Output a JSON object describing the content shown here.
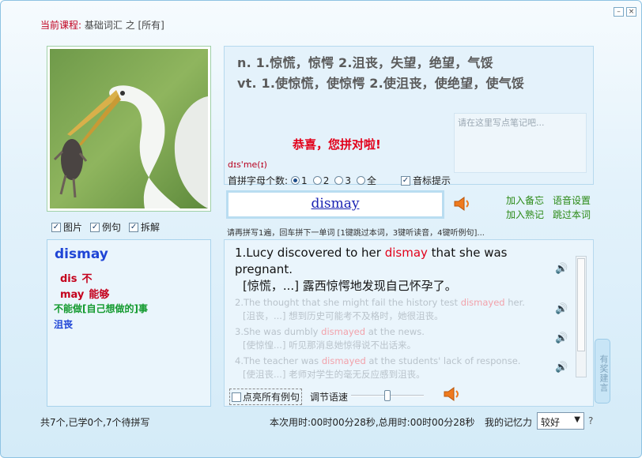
{
  "window": {
    "minimize_symbol": "–",
    "close_symbol": "×"
  },
  "course": {
    "label": "当前课程:",
    "value": "基础词汇 之 [所有]"
  },
  "options": {
    "picture": "图片",
    "example": "例句",
    "split": "拆解",
    "picture_checked": true,
    "example_checked": true,
    "split_checked": true
  },
  "split": {
    "word": "dismay",
    "parts": [
      {
        "piece": "dis",
        "meaning": "不"
      },
      {
        "piece": "may",
        "meaning": "能够"
      }
    ],
    "combined": "不能做[自己想做的]事",
    "result": "沮丧"
  },
  "definition": {
    "lines": [
      "n.  1.惊慌，惊愕  2.沮丧，失望，绝望，气馁",
      "vt.  1.使惊慌，使惊愕  2.使沮丧，使绝望，使气馁"
    ],
    "note_placeholder": "请在这里写点笔记吧...",
    "congrats": "恭喜，您拼对啦!",
    "phonetic": "dɪs'me(ɪ)",
    "letters_label": "首拼字母个数:",
    "letter_options": [
      "1",
      "2",
      "3",
      "全"
    ],
    "letter_selected": "1",
    "phonetic_hint": "音标提示",
    "phonetic_hint_checked": true
  },
  "answer": {
    "word": "dismay"
  },
  "actions": {
    "add_memo": "加入备忘",
    "add_known": "加入熟记",
    "voice_settings": "语音设置",
    "skip": "跳过本词"
  },
  "hint": "请再拼写1遍，回车拼下一单词 [1键跳过本词，3键听读音，4键听例句]...",
  "examples": {
    "main_pre": "1.Lucy discovered to her ",
    "main_kw": "dismay",
    "main_post": " that she was pregnant.",
    "main_cn": "[惊慌，...] 露西惊愕地发现自己怀孕了。",
    "others": [
      {
        "en_pre": "2.The thought that she might fail the history test ",
        "kw": "dismayed",
        "en_post": " her.",
        "cn": "[沮丧，...] 想到历史可能考不及格时，她很沮丧。"
      },
      {
        "en_pre": "3.She was dumbly ",
        "kw": "dismayed",
        "en_post": " at the news.",
        "cn": "[使惊惶...] 听见那消息她惊得说不出话来。"
      },
      {
        "en_pre": "4.The teacher was ",
        "kw": "dismayed",
        "en_post": " at the students' lack of response.",
        "cn": "[使沮丧...] 老师对学生的毫无反应感到沮丧。"
      }
    ],
    "show_all": "点亮所有例句",
    "speed_label": "调节语速",
    "speed_level": 0.5
  },
  "suggest": "有奖建言",
  "footer": {
    "stats": "共7个,已学0个,7个待拼写",
    "time": "本次用时:00时00分28秒,总用时:00时00分28秒",
    "memory_label": "我的记忆力",
    "memory_value": "较好",
    "help": "?"
  },
  "colors": {
    "accent_red": "#e2001a",
    "accent_blue": "#1f45d6",
    "accent_green": "#139a2e"
  }
}
